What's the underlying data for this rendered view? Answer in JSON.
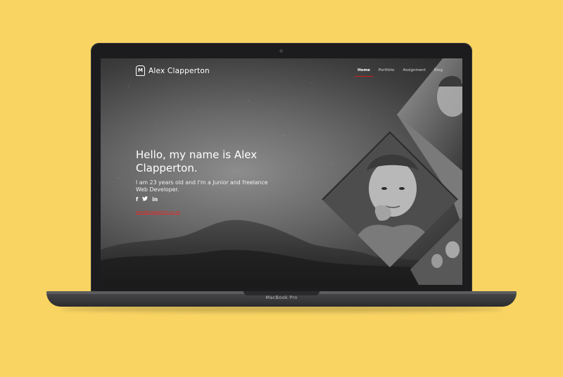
{
  "device": {
    "model_label": "MacBook Pro"
  },
  "site": {
    "logo_mark": "M",
    "brand_name": "Alex Clapperton",
    "nav": [
      {
        "label": "Home",
        "active": true
      },
      {
        "label": "Portfolio",
        "active": false
      },
      {
        "label": "Assignment",
        "active": false
      },
      {
        "label": "Blog",
        "active": false
      }
    ],
    "hero": {
      "heading": "Hello, my name is Alex Clapperton.",
      "subtext": "I am 23 years old and I'm a Junior and freelance Web Developer.",
      "social": [
        {
          "icon": "facebook-icon",
          "glyph": "f"
        },
        {
          "icon": "twitter-icon",
          "glyph": "t"
        },
        {
          "icon": "linkedin-icon",
          "glyph": "in"
        }
      ],
      "email": "alex@clapperton.co.uk"
    }
  },
  "colors": {
    "background": "#f9d463",
    "accent": "#d81e1e",
    "screen_dark": "#2a2a2a"
  }
}
